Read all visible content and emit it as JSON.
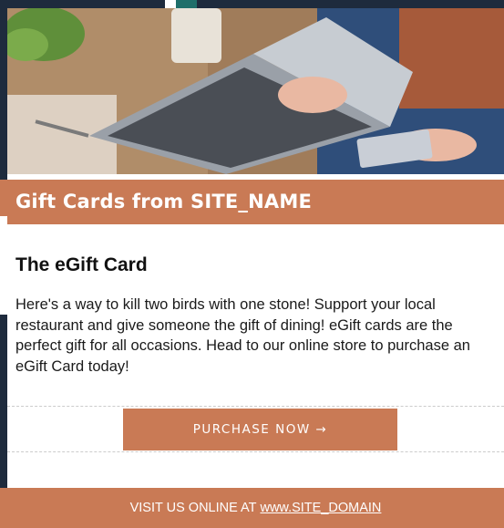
{
  "hero": {
    "image_desc": "laptop-shopping-photo"
  },
  "banner": {
    "title": "Gift Cards from SITE_NAME"
  },
  "content": {
    "heading": "The eGift Card",
    "body": "Here's a way to kill two birds with one stone! Support your local restaurant and give someone the gift of dining! eGift cards are the perfect gift for all occasions. Head to our online store to purchase an eGift Card today!"
  },
  "cta": {
    "label": "PURCHASE NOW →"
  },
  "footer": {
    "prefix": "VISIT US ONLINE AT",
    "link_text": "www.SITE_DOMAIN"
  },
  "colors": {
    "accent": "#c97a55",
    "background": "#1e2b3d",
    "card": "#ffffff"
  }
}
